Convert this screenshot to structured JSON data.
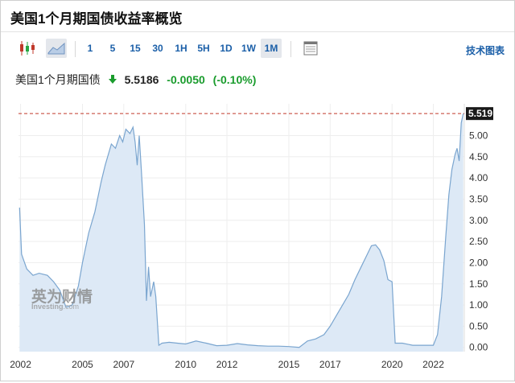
{
  "page": {
    "title": "美国1个月期国债收益率概览"
  },
  "toolbar": {
    "candlestick_icon": "candlestick-icon",
    "area_chart_icon": "area-chart-icon",
    "intervals": [
      "1",
      "5",
      "15",
      "30",
      "1H",
      "5H",
      "1D",
      "1W",
      "1M"
    ],
    "active_interval": "1M",
    "table_icon": "table-icon",
    "tech_chart_label": "技术图表"
  },
  "quote": {
    "name": "美国1个月期国债",
    "direction_icon": "down-arrow-icon",
    "price": "5.5186",
    "change": "-0.0050",
    "change_pct": "(-0.10%)",
    "change_color": "#1a9c2d"
  },
  "watermark": {
    "logo_text": "英为财情",
    "sub_text": "Investing",
    "sub_suffix": ".com"
  },
  "chart_data": {
    "type": "area",
    "x_tick_labels": [
      "2002",
      "2005",
      "2007",
      "2010",
      "2012",
      "2015",
      "2017",
      "2020",
      "2022"
    ],
    "x_ticks": [
      2002.0,
      2005.0,
      2007.0,
      2010.0,
      2012.0,
      2015.0,
      2017.0,
      2020.0,
      2022.0
    ],
    "xlim": [
      2001.9,
      2023.5
    ],
    "y_ticks": [
      0.0,
      0.5,
      1.0,
      1.5,
      2.0,
      2.5,
      3.0,
      3.5,
      4.0,
      4.5,
      5.0
    ],
    "y_tick_labels": [
      "0.00",
      "0.50",
      "1.00",
      "1.50",
      "2.00",
      "2.50",
      "3.00",
      "3.50",
      "4.00",
      "4.50",
      "5.00"
    ],
    "ylim": [
      -0.1,
      5.75
    ],
    "last_value_label": "5.519",
    "last_value": 5.519,
    "grid": true,
    "series": [
      {
        "values": [
          [
            2001.95,
            3.3
          ],
          [
            2002.05,
            2.2
          ],
          [
            2002.3,
            1.85
          ],
          [
            2002.6,
            1.7
          ],
          [
            2002.9,
            1.75
          ],
          [
            2003.3,
            1.7
          ],
          [
            2003.6,
            1.55
          ],
          [
            2003.9,
            1.35
          ],
          [
            2004.2,
            0.95
          ],
          [
            2004.5,
            1.0
          ],
          [
            2004.8,
            1.45
          ],
          [
            2005.0,
            2.0
          ],
          [
            2005.3,
            2.7
          ],
          [
            2005.6,
            3.2
          ],
          [
            2005.9,
            3.9
          ],
          [
            2006.1,
            4.3
          ],
          [
            2006.4,
            4.8
          ],
          [
            2006.6,
            4.7
          ],
          [
            2006.8,
            5.0
          ],
          [
            2006.95,
            4.85
          ],
          [
            2007.1,
            5.15
          ],
          [
            2007.3,
            5.05
          ],
          [
            2007.45,
            5.2
          ],
          [
            2007.55,
            4.85
          ],
          [
            2007.65,
            4.3
          ],
          [
            2007.75,
            5.0
          ],
          [
            2007.85,
            4.2
          ],
          [
            2008.0,
            2.9
          ],
          [
            2008.1,
            1.1
          ],
          [
            2008.2,
            1.9
          ],
          [
            2008.3,
            1.2
          ],
          [
            2008.45,
            1.55
          ],
          [
            2008.55,
            1.2
          ],
          [
            2008.7,
            0.05
          ],
          [
            2008.85,
            0.1
          ],
          [
            2009.2,
            0.12
          ],
          [
            2009.6,
            0.1
          ],
          [
            2010.0,
            0.08
          ],
          [
            2010.5,
            0.15
          ],
          [
            2011.0,
            0.1
          ],
          [
            2011.5,
            0.04
          ],
          [
            2012.0,
            0.05
          ],
          [
            2012.5,
            0.09
          ],
          [
            2013.0,
            0.06
          ],
          [
            2013.5,
            0.04
          ],
          [
            2014.0,
            0.03
          ],
          [
            2014.5,
            0.03
          ],
          [
            2015.0,
            0.02
          ],
          [
            2015.5,
            0.0
          ],
          [
            2015.9,
            0.15
          ],
          [
            2016.3,
            0.2
          ],
          [
            2016.7,
            0.3
          ],
          [
            2017.0,
            0.5
          ],
          [
            2017.3,
            0.75
          ],
          [
            2017.6,
            1.0
          ],
          [
            2017.9,
            1.25
          ],
          [
            2018.2,
            1.6
          ],
          [
            2018.5,
            1.9
          ],
          [
            2018.8,
            2.2
          ],
          [
            2019.0,
            2.4
          ],
          [
            2019.2,
            2.42
          ],
          [
            2019.4,
            2.3
          ],
          [
            2019.6,
            2.05
          ],
          [
            2019.8,
            1.6
          ],
          [
            2020.0,
            1.55
          ],
          [
            2020.15,
            0.1
          ],
          [
            2020.5,
            0.1
          ],
          [
            2021.0,
            0.05
          ],
          [
            2021.5,
            0.05
          ],
          [
            2022.0,
            0.05
          ],
          [
            2022.2,
            0.3
          ],
          [
            2022.4,
            1.2
          ],
          [
            2022.6,
            2.6
          ],
          [
            2022.75,
            3.6
          ],
          [
            2022.9,
            4.2
          ],
          [
            2023.05,
            4.55
          ],
          [
            2023.15,
            4.7
          ],
          [
            2023.25,
            4.4
          ],
          [
            2023.35,
            5.3
          ],
          [
            2023.45,
            5.52
          ]
        ]
      }
    ]
  }
}
